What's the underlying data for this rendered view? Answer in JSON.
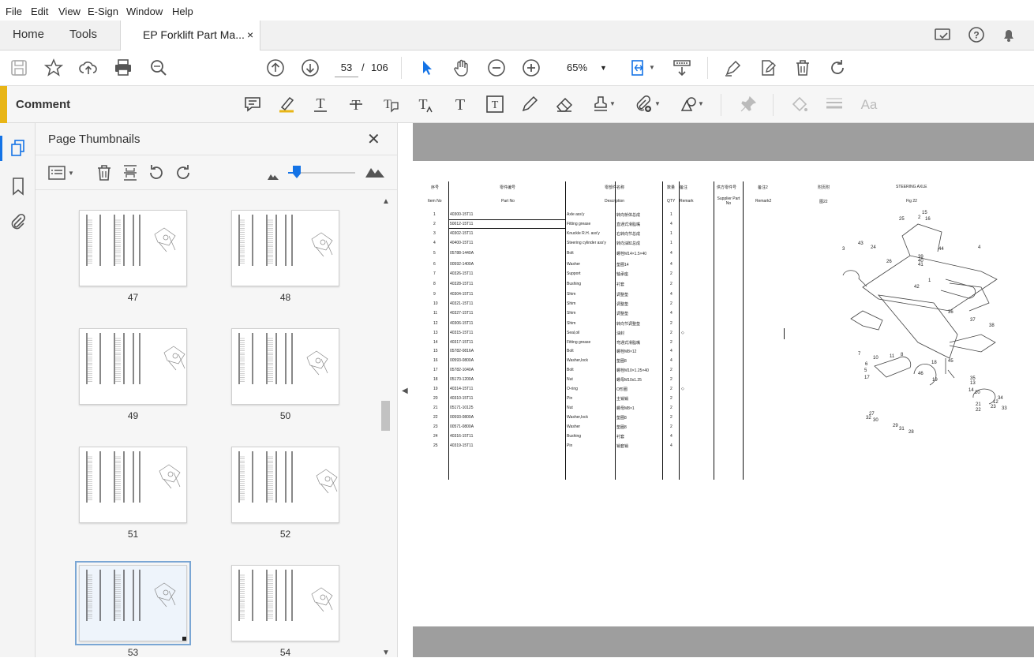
{
  "menu": [
    "File",
    "Edit",
    "View",
    "E-Sign",
    "Window",
    "Help"
  ],
  "tabs": {
    "home": "Home",
    "tools": "Tools",
    "document": "EP Forklift Part Ma...",
    "close": "×"
  },
  "toolbar": {
    "page_current": "53",
    "page_sep": "/",
    "page_total": "106",
    "zoom": "65%"
  },
  "comment_bar": {
    "label": "Comment"
  },
  "panel": {
    "title": "Page Thumbnails",
    "close": "✕"
  },
  "thumbnails": [
    {
      "num": "47"
    },
    {
      "num": "48"
    },
    {
      "num": "49"
    },
    {
      "num": "50"
    },
    {
      "num": "51"
    },
    {
      "num": "52"
    },
    {
      "num": "53",
      "selected": true
    },
    {
      "num": "54"
    }
  ],
  "parts_page": {
    "headers_cn": [
      "序号",
      "零件编号",
      "零部件名称",
      "数量",
      "备注",
      "供方零件号",
      "备注2",
      "附页附",
      "STEERING AXLE"
    ],
    "headers_en": [
      "Item No",
      "Part No",
      "Description",
      "QTY",
      "Remark",
      "Supplier Part No",
      "Remark2",
      "图22",
      "Fig 22"
    ],
    "rows": [
      {
        "item": "1",
        "part": "40300-15T11",
        "desc": "Axle ass'y",
        "cn": "转向桥体总成",
        "qty": "1",
        "remark": ""
      },
      {
        "item": "2",
        "part": "50012-15T11",
        "desc": "Fitting grease",
        "cn": "直通式滑脂嘴",
        "qty": "4",
        "remark": ""
      },
      {
        "item": "3",
        "part": "40302-15T11",
        "desc": "Knuckle R.H. ass'y",
        "cn": "右转向节总成",
        "qty": "1",
        "remark": ""
      },
      {
        "item": "4",
        "part": "40400-15T11",
        "desc": "Steering cylinder ass'y",
        "cn": "转向油缸总成",
        "qty": "1",
        "remark": ""
      },
      {
        "item": "5",
        "part": "05788-1440A",
        "desc": "Bolt",
        "cn": "螺栓M14×1.5×40",
        "qty": "4",
        "remark": ""
      },
      {
        "item": "6",
        "part": "00592-1400A",
        "desc": "Washer",
        "cn": "垫圈14",
        "qty": "4",
        "remark": ""
      },
      {
        "item": "7",
        "part": "40326-15T11",
        "desc": "Support",
        "cn": "轴承座",
        "qty": "2",
        "remark": ""
      },
      {
        "item": "8",
        "part": "40328-15T11",
        "desc": "Bushing",
        "cn": "衬套",
        "qty": "2",
        "remark": ""
      },
      {
        "item": "9",
        "part": "40304-15T11",
        "desc": "Shim",
        "cn": "调整垫",
        "qty": "4",
        "remark": ""
      },
      {
        "item": "10",
        "part": "40321-15T11",
        "desc": "Shim",
        "cn": "调整垫",
        "qty": "2",
        "remark": ""
      },
      {
        "item": "11",
        "part": "40327-15T11",
        "desc": "Shim",
        "cn": "调整垫",
        "qty": "4",
        "remark": ""
      },
      {
        "item": "12",
        "part": "40306-15T11",
        "desc": "Shim",
        "cn": "转向节调整垫",
        "qty": "2",
        "remark": ""
      },
      {
        "item": "13",
        "part": "40315-15T11",
        "desc": "Seal,oil",
        "cn": "油封",
        "qty": "2",
        "remark": "◇"
      },
      {
        "item": "14",
        "part": "40317-15T11",
        "desc": "Fitting grease",
        "cn": "弯通式滑脂嘴",
        "qty": "2",
        "remark": ""
      },
      {
        "item": "15",
        "part": "05782-0816A",
        "desc": "Bolt",
        "cn": "螺栓M8×12",
        "qty": "4",
        "remark": ""
      },
      {
        "item": "16",
        "part": "00593-0800A",
        "desc": "Washer,lock",
        "cn": "垫圈8",
        "qty": "4",
        "remark": ""
      },
      {
        "item": "17",
        "part": "05782-1040A",
        "desc": "Bolt",
        "cn": "螺栓M10×1.25×40",
        "qty": "2",
        "remark": ""
      },
      {
        "item": "18",
        "part": "05170-1200A",
        "desc": "Nut",
        "cn": "螺母M10x1.25",
        "qty": "2",
        "remark": ""
      },
      {
        "item": "19",
        "part": "40314-15T11",
        "desc": "O-ring",
        "cn": "O形圈",
        "qty": "2",
        "remark": "◇"
      },
      {
        "item": "20",
        "part": "40310-15T11",
        "desc": "Pin",
        "cn": "主销销",
        "qty": "2",
        "remark": ""
      },
      {
        "item": "21",
        "part": "05171-10125",
        "desc": "Nut",
        "cn": "螺母M8×1",
        "qty": "2",
        "remark": ""
      },
      {
        "item": "22",
        "part": "00593-0800A",
        "desc": "Washer,lock",
        "cn": "垫圈8",
        "qty": "2",
        "remark": ""
      },
      {
        "item": "23",
        "part": "00571-0800A",
        "desc": "Washer",
        "cn": "垫圈8",
        "qty": "2",
        "remark": ""
      },
      {
        "item": "24",
        "part": "40316-15T11",
        "desc": "Bushing",
        "cn": "衬套",
        "qty": "4",
        "remark": ""
      },
      {
        "item": "25",
        "part": "40319-15T11",
        "desc": "Pin",
        "cn": "销套销",
        "qty": "4",
        "remark": ""
      }
    ],
    "callouts": [
      "15",
      "16",
      "2",
      "25",
      "3",
      "43",
      "24",
      "44",
      "4",
      "26",
      "39",
      "40",
      "41",
      "1",
      "42",
      "36",
      "37",
      "38",
      "7",
      "10",
      "11",
      "8",
      "6",
      "5",
      "17",
      "18",
      "45",
      "46",
      "19",
      "35",
      "13",
      "14",
      "20",
      "21",
      "22",
      "23",
      "12",
      "34",
      "33",
      "27",
      "32",
      "30",
      "29",
      "31",
      "28"
    ]
  }
}
